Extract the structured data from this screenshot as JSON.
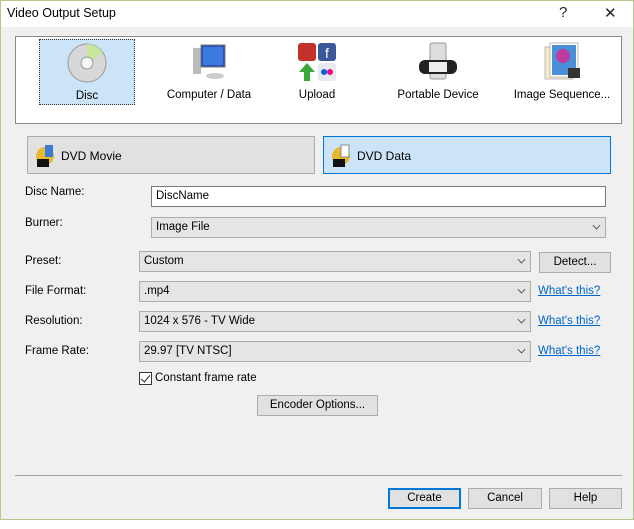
{
  "window": {
    "title": "Video Output Setup",
    "help_label": "?",
    "close_label": "✕",
    "border_color": "#b5c98a"
  },
  "categories": [
    {
      "label": "Disc",
      "icon": "disc-icon",
      "selected": true
    },
    {
      "label": "Computer / Data",
      "icon": "computer-icon",
      "selected": false
    },
    {
      "label": "Upload",
      "icon": "upload-icon",
      "selected": false
    },
    {
      "label": "Portable Device",
      "icon": "portable-device-icon",
      "selected": false
    },
    {
      "label": "Image Sequence...",
      "icon": "image-sequence-icon",
      "selected": false
    }
  ],
  "modes": [
    {
      "label": "DVD Movie",
      "icon": "dvd-movie-icon",
      "selected": false
    },
    {
      "label": "DVD Data",
      "icon": "dvd-data-icon",
      "selected": true
    }
  ],
  "form": {
    "disc_name": {
      "label": "Disc Name:",
      "value": "DiscName"
    },
    "burner": {
      "label": "Burner:",
      "value": "Image File"
    },
    "preset": {
      "label": "Preset:",
      "value": "Custom",
      "button": "Detect..."
    },
    "file_format": {
      "label": "File Format:",
      "value": ".mp4",
      "link": "What's this?"
    },
    "resolution": {
      "label": "Resolution:",
      "value": "1024 x 576 - TV Wide",
      "link": "What's this?"
    },
    "frame_rate": {
      "label": "Frame Rate:",
      "value": "29.97 [TV NTSC]",
      "link": "What's this?"
    },
    "constant_frame_rate": {
      "label": "Constant frame rate",
      "checked": true
    },
    "encoder_options": "Encoder Options..."
  },
  "footer": {
    "create": "Create",
    "cancel": "Cancel",
    "help": "Help"
  },
  "colors": {
    "accent": "#0078d7",
    "selected_bg": "#cce4f7",
    "link": "#0066cc"
  }
}
